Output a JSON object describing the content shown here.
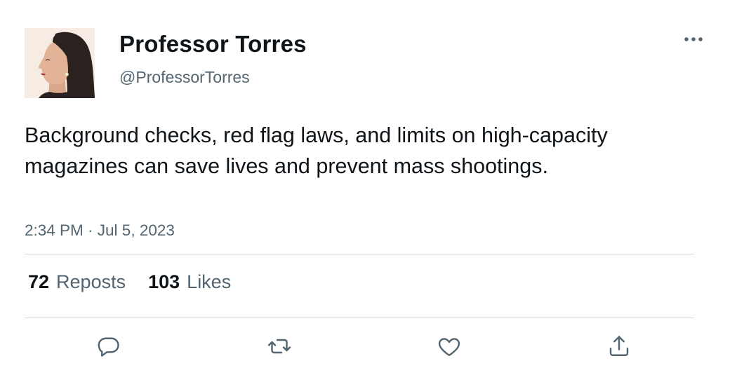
{
  "author": {
    "display_name": "Professor Torres",
    "handle": "@ProfessorTorres",
    "avatar_icon": "profile-photo"
  },
  "tweet": {
    "text": "Background checks, red flag laws, and limits on high-capacity magazines can save lives and prevent mass shootings.",
    "timestamp": "2:34 PM · Jul 5, 2023"
  },
  "stats": {
    "reposts_count": "72",
    "reposts_label": "Reposts",
    "likes_count": "103",
    "likes_label": "Likes"
  },
  "actions": [
    {
      "icon": "reply-icon"
    },
    {
      "icon": "repost-icon"
    },
    {
      "icon": "like-icon"
    },
    {
      "icon": "share-icon"
    }
  ],
  "colors": {
    "primary_text": "#0f1419",
    "secondary_text": "#536471",
    "divider": "#cfd9de"
  }
}
